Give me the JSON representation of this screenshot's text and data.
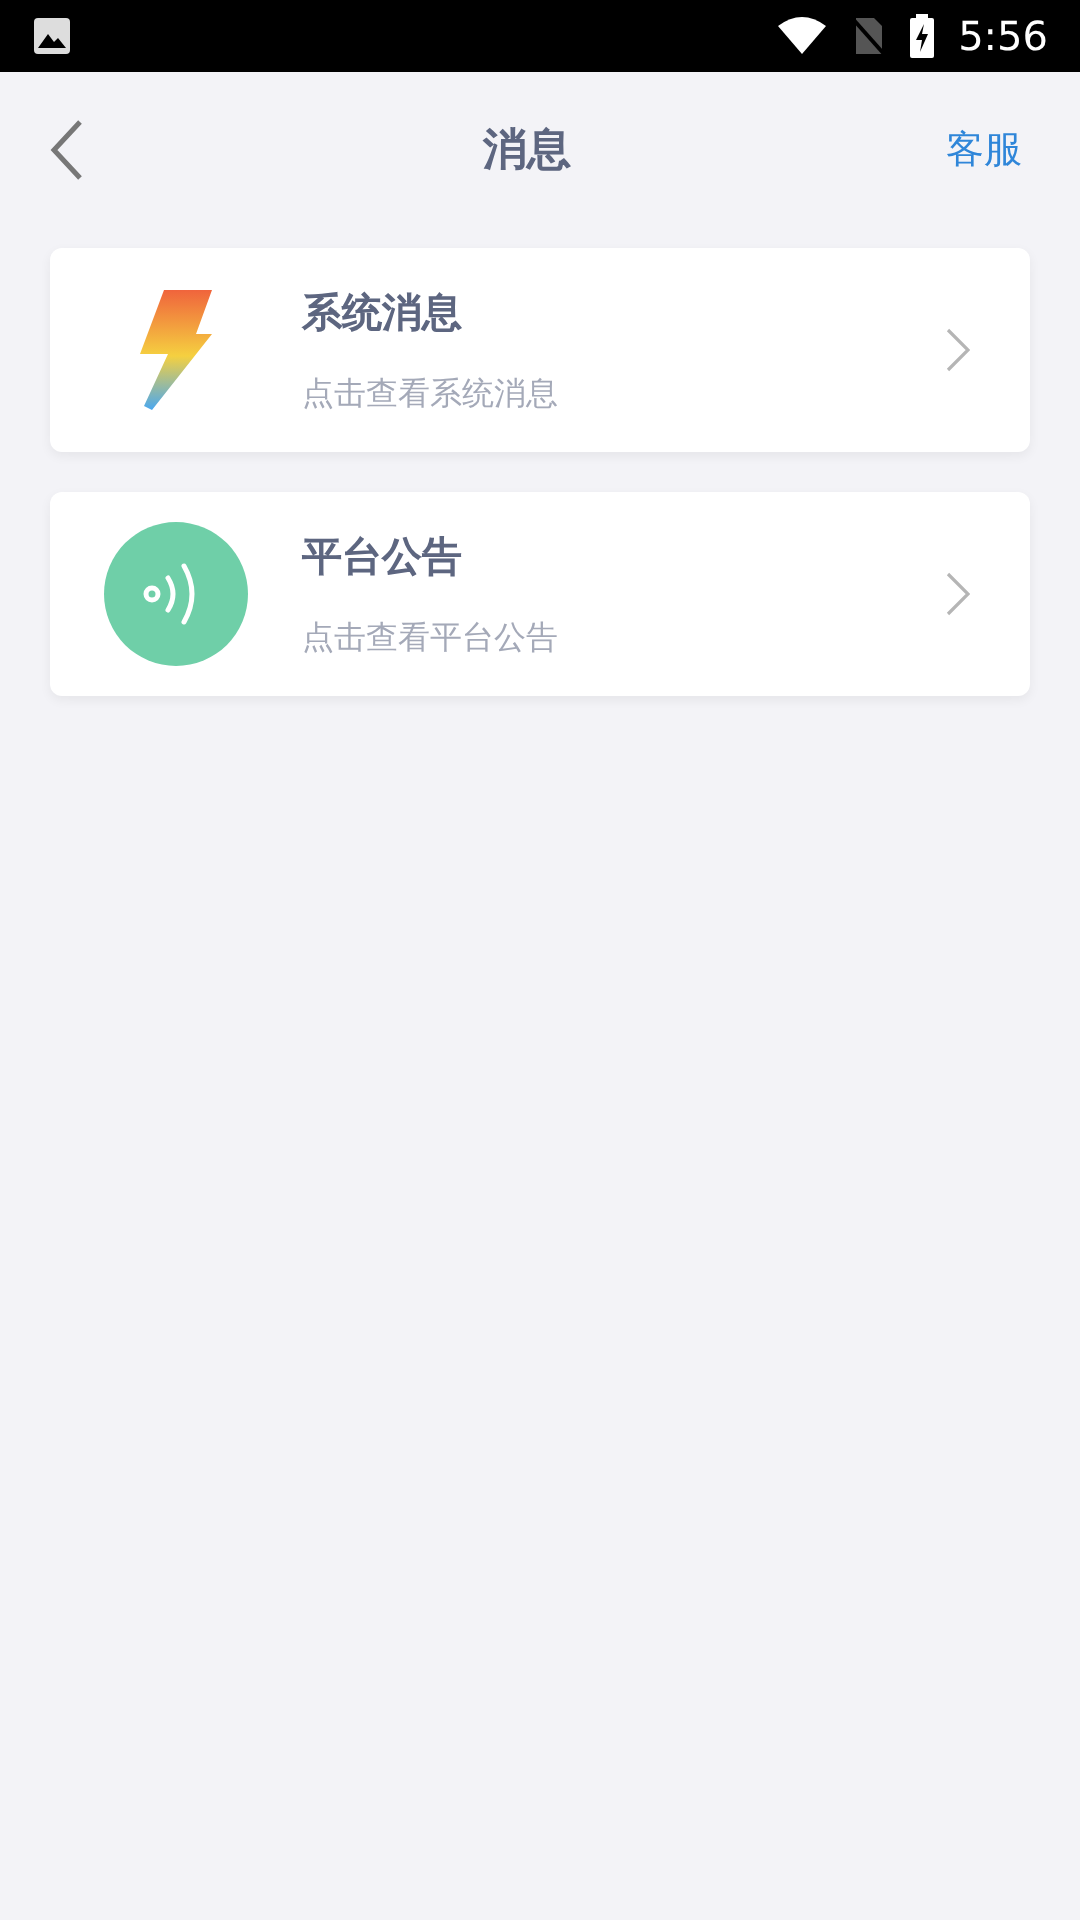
{
  "status_bar": {
    "time": "5:56"
  },
  "header": {
    "title": "消息",
    "action": "客服"
  },
  "items": [
    {
      "kind": "bolt",
      "title": "系统消息",
      "subtitle": "点击查看系统消息"
    },
    {
      "kind": "broadcast",
      "title": "平台公告",
      "subtitle": "点击查看平台公告"
    }
  ]
}
